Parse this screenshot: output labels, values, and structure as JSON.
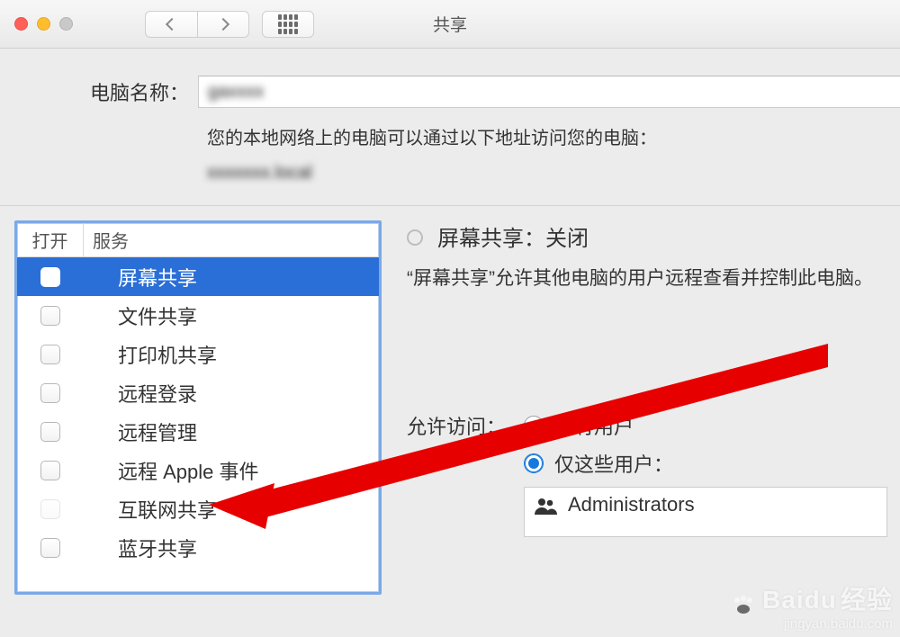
{
  "window": {
    "title": "共享"
  },
  "toolbar": {
    "back": "返回",
    "forward": "向前",
    "apps": "显示全部"
  },
  "computer_name": {
    "label": "电脑名称：",
    "value": "gaxxxx",
    "hint": "您的本地网络上的电脑可以通过以下地址访问您的电脑：",
    "address": "xxxxxxx.local"
  },
  "services": {
    "headers": {
      "on": "打开",
      "service": "服务"
    },
    "items": [
      {
        "label": "屏幕共享",
        "checked": false,
        "selected": true
      },
      {
        "label": "文件共享",
        "checked": false,
        "selected": false
      },
      {
        "label": "打印机共享",
        "checked": false,
        "selected": false
      },
      {
        "label": "远程登录",
        "checked": false,
        "selected": false
      },
      {
        "label": "远程管理",
        "checked": false,
        "selected": false
      },
      {
        "label": "远程 Apple 事件",
        "checked": false,
        "selected": false
      },
      {
        "label": "互联网共享",
        "checked": false,
        "selected": false,
        "dim": true
      },
      {
        "label": "蓝牙共享",
        "checked": false,
        "selected": false
      }
    ]
  },
  "detail": {
    "status": "屏幕共享：关闭",
    "description": "“屏幕共享”允许其他电脑的用户远程查看并控制此电脑。",
    "allow_label": "允许访问：",
    "options": {
      "all": "所有用户",
      "only": "仅这些用户："
    },
    "selected_option": "only",
    "users": [
      "Administrators"
    ]
  },
  "watermark": {
    "brand": "Baidu",
    "sub": "经验",
    "url": "jingyan.baidu.com"
  }
}
